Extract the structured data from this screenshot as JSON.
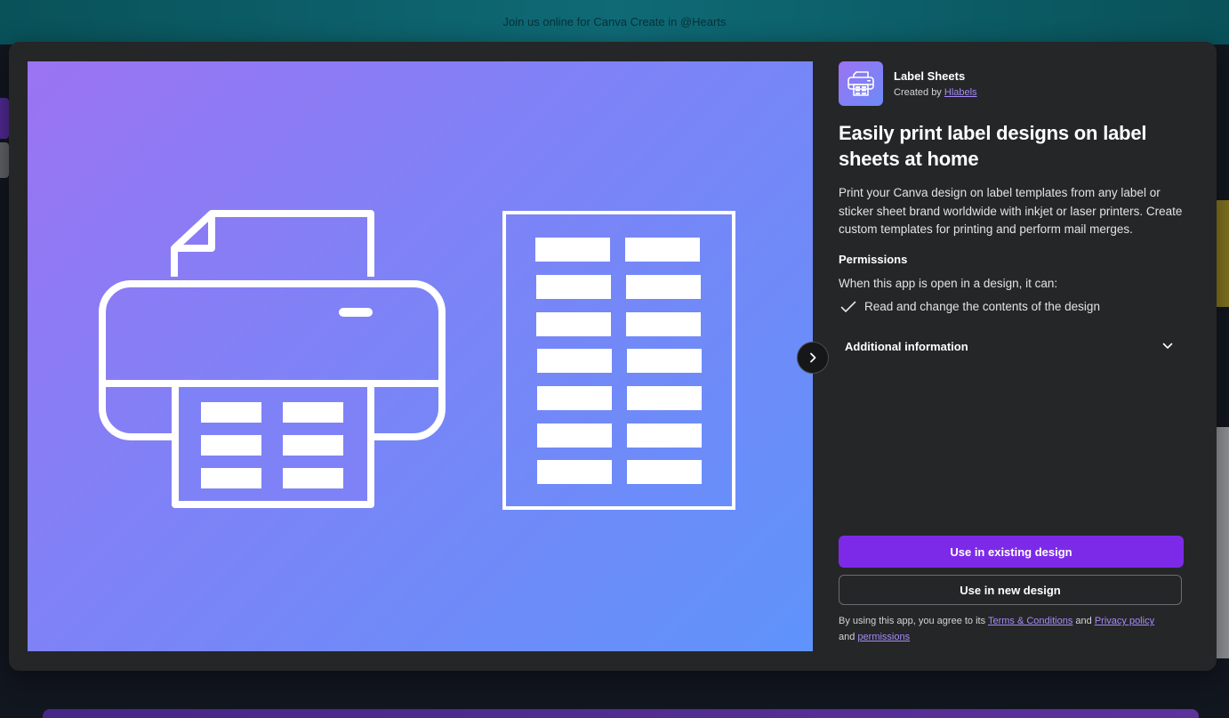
{
  "background": {
    "banner_text": "Join us online for Canva Create in @Hearts"
  },
  "app": {
    "name": "Label Sheets",
    "created_by_prefix": "Created by",
    "creator": "Hlabels",
    "headline": "Easily print label designs on label sheets at home",
    "description": "Print your Canva design on label templates from any label or sticker sheet brand worldwide with inkjet or laser printers. Create custom templates for printing and perform mail merges."
  },
  "permissions": {
    "title": "Permissions",
    "subtitle": "When this app is open in a design, it can:",
    "items": [
      "Read and change the contents of the design"
    ]
  },
  "additional_info": {
    "label": "Additional information"
  },
  "actions": {
    "primary": "Use in existing design",
    "secondary": "Use in new design"
  },
  "legal": {
    "prefix": "By using this app, you agree to its",
    "terms": "Terms & Conditions",
    "and1": "and",
    "privacy": "Privacy policy",
    "and2": "and",
    "permissions": "permissions"
  },
  "colors": {
    "modal_bg": "#252627",
    "accent": "#7d2ae8",
    "link": "#a88bfa"
  },
  "icons": {
    "hero": [
      "printer-icon",
      "label-sheet-icon"
    ],
    "next": "chevron-right-icon",
    "check": "check-icon",
    "expand": "chevron-down-icon"
  }
}
